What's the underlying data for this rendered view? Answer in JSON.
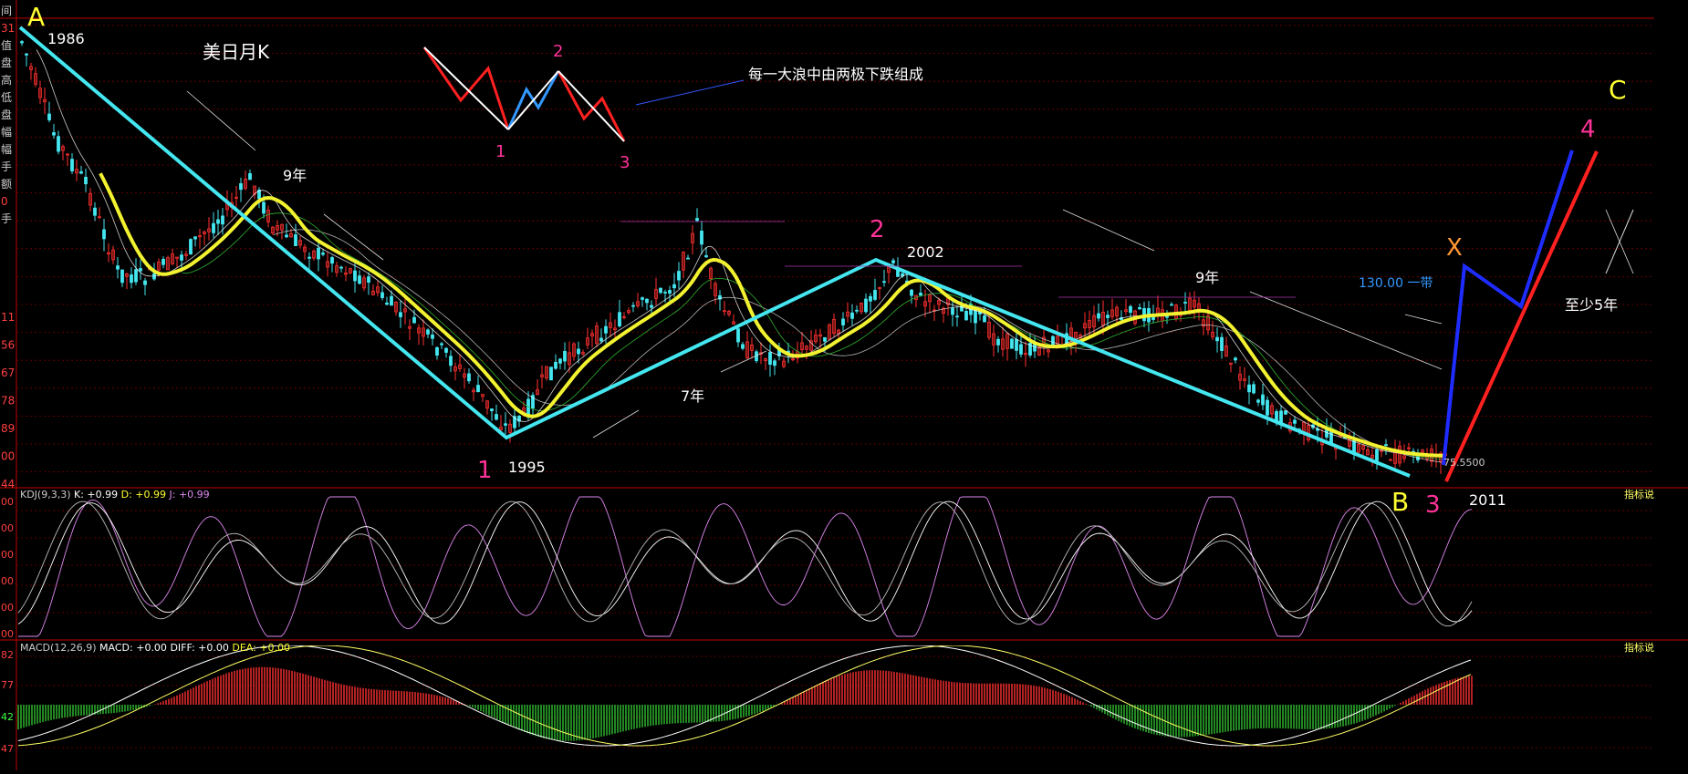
{
  "chart_data": {
    "type": "candlestick-annotated",
    "title": "美日月K",
    "axis_side_labels": [
      "间",
      "31",
      "值",
      "盘",
      "高",
      "低",
      "盘",
      "幅",
      "幅",
      "手",
      "额",
      "0",
      "手",
      "11",
      "56",
      "67",
      "78",
      "89",
      "00",
      "44"
    ],
    "wave_letters": [
      {
        "id": "A",
        "text": "A",
        "color": "#ffff33"
      },
      {
        "id": "B",
        "text": "B",
        "color": "#ffff33"
      },
      {
        "id": "C",
        "text": "C",
        "color": "#ffff33"
      },
      {
        "id": "X",
        "text": "X",
        "color": "#ff9933"
      }
    ],
    "wave_numbers": [
      {
        "id": "w1",
        "text": "1",
        "color": "#ff3399"
      },
      {
        "id": "w2",
        "text": "2",
        "color": "#ff3399"
      },
      {
        "id": "w3",
        "text": "3",
        "color": "#ff3399"
      },
      {
        "id": "w4",
        "text": "4",
        "color": "#ff3399"
      }
    ],
    "year_labels": [
      {
        "id": "y1986",
        "text": "1986"
      },
      {
        "id": "y1995",
        "text": "1995"
      },
      {
        "id": "y2002",
        "text": "2002"
      },
      {
        "id": "y2011",
        "text": "2011"
      }
    ],
    "duration_labels": [
      {
        "id": "d9a",
        "text": "9年"
      },
      {
        "id": "d7",
        "text": "7年"
      },
      {
        "id": "d9b",
        "text": "9年"
      },
      {
        "id": "d5",
        "text": "至少5年"
      }
    ],
    "inset": {
      "numbers": [
        "1",
        "2",
        "3"
      ],
      "note": "每一大浪中由两极下跌组成"
    },
    "target_note": "130.00 一带",
    "price_tag": "75.5500",
    "kdj": {
      "label": "KDJ(9,3,3)",
      "k": "K: +0.99",
      "d": "D: +0.99",
      "j": "J: +0.99",
      "ticks": [
        "00",
        "00",
        "00",
        "00",
        "00",
        "00"
      ],
      "tool": "指标说"
    },
    "macd": {
      "label": "MACD(12,26,9)",
      "macd": "MACD: +0.00",
      "diff": "DIFF: +0.00",
      "dea": "DEA: +0.00",
      "ticks": [
        "82",
        "77",
        "42",
        "47"
      ],
      "tool": "指标说"
    },
    "colors": {
      "trend": "#44e6f0",
      "ma_main": "#f2f230",
      "bear_wave": "#ff2020",
      "bull_wave": "#1f2cff",
      "up_candle": "#ff3030",
      "down_candle": "#44e6f0",
      "macd_up": "#ff3030",
      "macd_down": "#30c030",
      "kdj_j": "#dd88ee",
      "grid": "#7a0000"
    }
  }
}
